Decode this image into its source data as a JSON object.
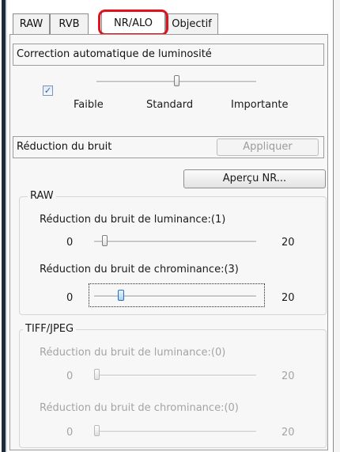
{
  "tabs": [
    {
      "label": "RAW",
      "active": false
    },
    {
      "label": "RVB",
      "active": false
    },
    {
      "label": "NR/ALO",
      "active": true
    },
    {
      "label": "Objectif",
      "active": false
    }
  ],
  "alo": {
    "title": "Correction automatique de luminosité",
    "checkbox_checked": true,
    "checkbox_mark": "✓",
    "slider_level": 1,
    "slider_max": 2,
    "labels": {
      "low": "Faible",
      "mid": "Standard",
      "high": "Importante"
    }
  },
  "noise": {
    "title": "Réduction du bruit",
    "apply_button": "Appliquer",
    "preview_button": "Aperçu NR...",
    "raw": {
      "group_label": "RAW",
      "luminance": {
        "label": "Réduction du bruit de luminance:(1)",
        "min": "0",
        "max": "20",
        "value": 1
      },
      "chrominance": {
        "label": "Réduction du bruit de chrominance:(3)",
        "min": "0",
        "max": "20",
        "value": 3
      }
    },
    "tiff_jpeg": {
      "group_label": "TIFF/JPEG",
      "luminance": {
        "label": "Réduction du bruit de luminance:(0)",
        "min": "0",
        "max": "20",
        "value": 0
      },
      "chrominance": {
        "label": "Réduction du bruit de chrominance:(0)",
        "min": "0",
        "max": "20",
        "value": 0
      }
    }
  },
  "colors": {
    "highlight": "#e0121d",
    "selected_thumb": "#a9d2f2"
  }
}
